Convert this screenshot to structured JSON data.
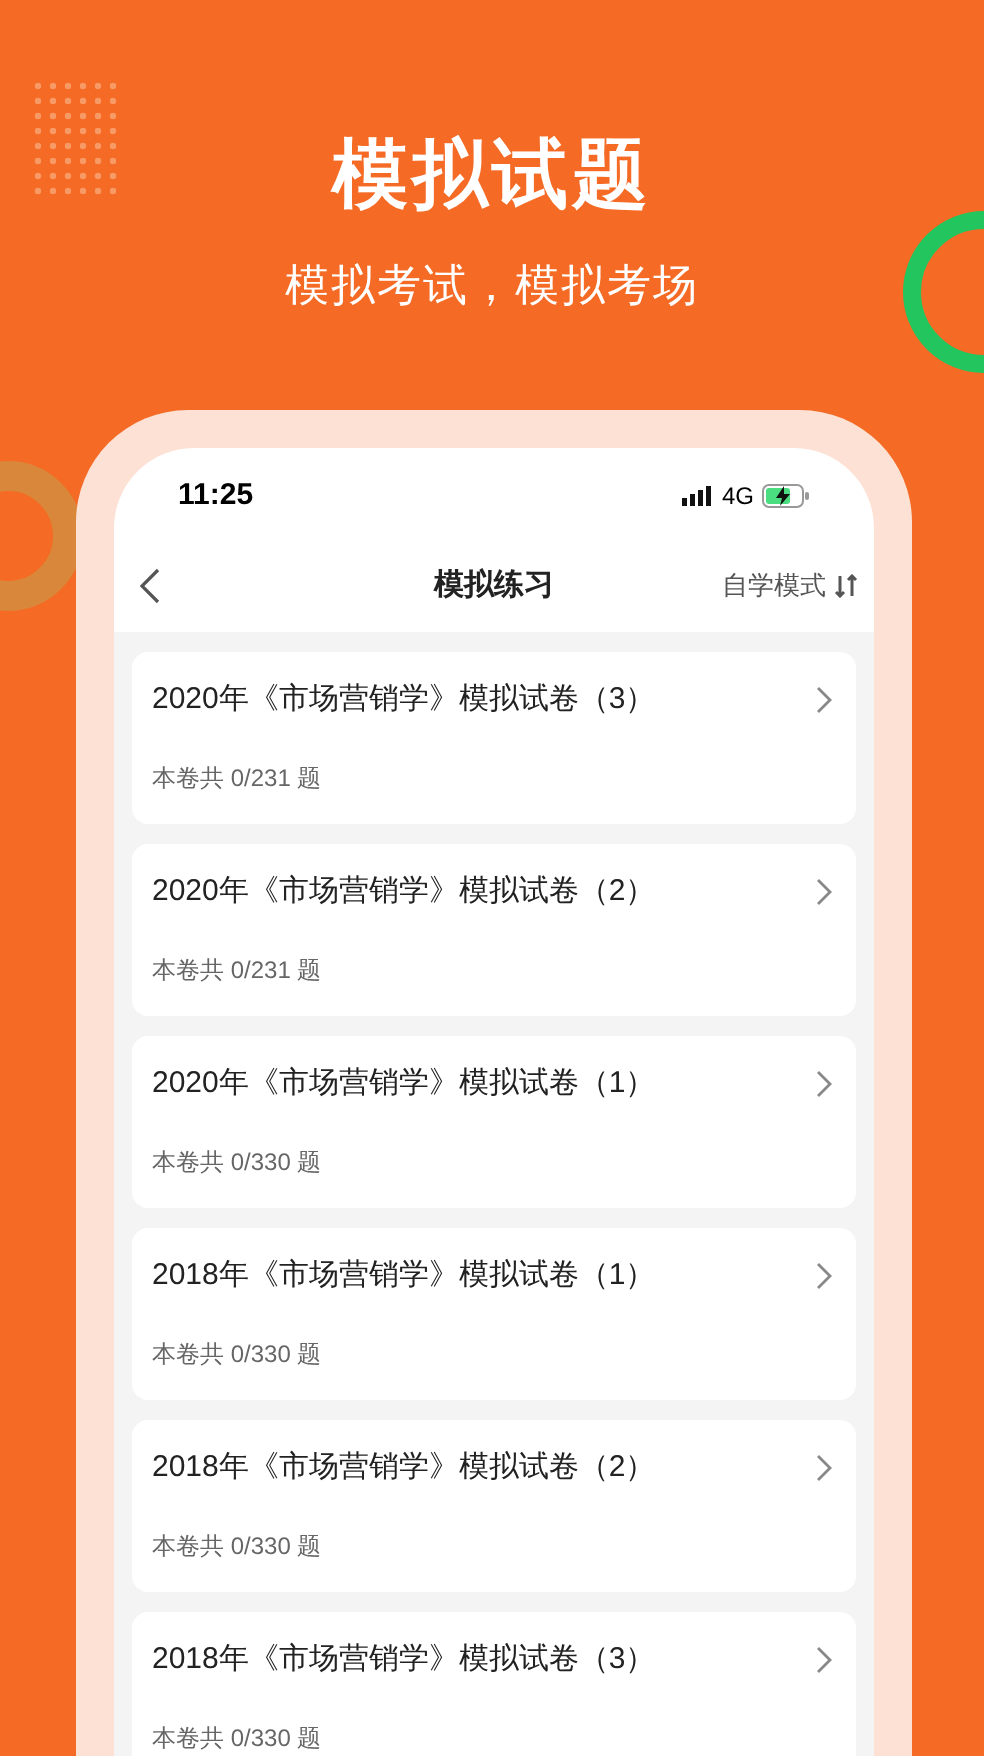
{
  "banner": {
    "title": "模拟试题",
    "subtitle": "模拟考试，模拟考场"
  },
  "status_bar": {
    "time": "11:25",
    "network": "4G"
  },
  "nav": {
    "title": "模拟练习",
    "mode": "自学模式"
  },
  "papers": [
    {
      "title": "2020年《市场营销学》模拟试卷（3）",
      "count": "本卷共 0/231 题"
    },
    {
      "title": "2020年《市场营销学》模拟试卷（2）",
      "count": "本卷共 0/231 题"
    },
    {
      "title": "2020年《市场营销学》模拟试卷（1）",
      "count": "本卷共 0/330 题"
    },
    {
      "title": "2018年《市场营销学》模拟试卷（1）",
      "count": "本卷共 0/330 题"
    },
    {
      "title": "2018年《市场营销学》模拟试卷（2）",
      "count": "本卷共 0/330 题"
    },
    {
      "title": "2018年《市场营销学》模拟试卷（3）",
      "count": "本卷共 0/330 题"
    }
  ]
}
